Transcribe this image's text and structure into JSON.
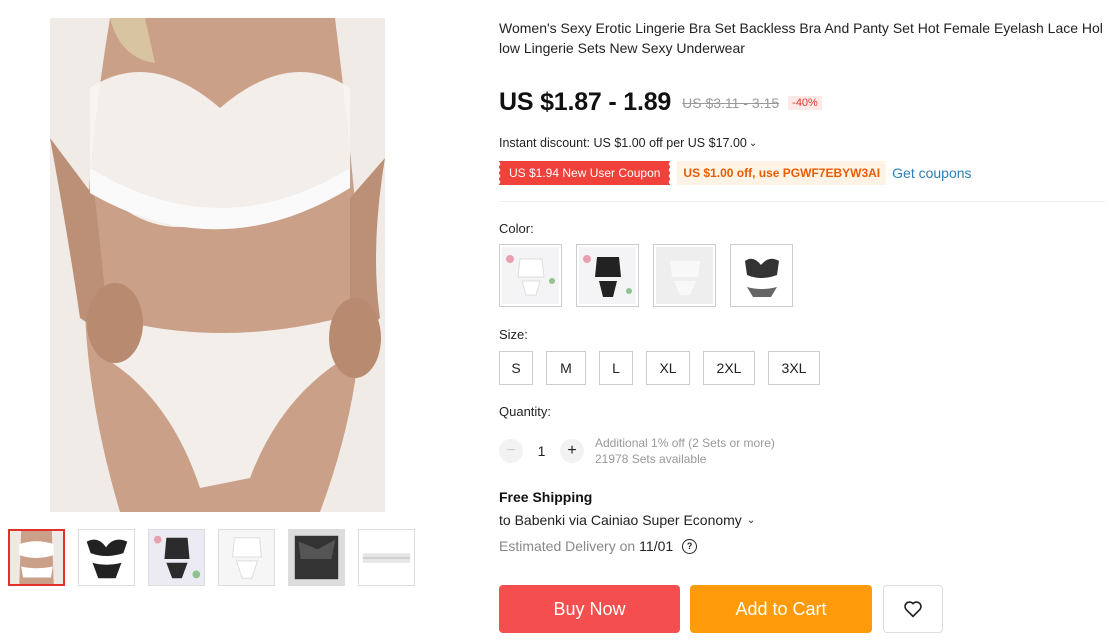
{
  "product": {
    "title": "Women's Sexy Erotic Lingerie Bra Set Backless Bra And Panty Set Hot Female Eyelash Lace Hollow Lingerie Sets New Sexy Underwear"
  },
  "price": {
    "current": "US $1.87 - 1.89",
    "original": "US $3.11 - 3.15",
    "discount": "-40%"
  },
  "instant_discount": "Instant discount: US $1.00 off per US $17.00",
  "coupons": {
    "new_user": "US $1.94 New User Coupon",
    "code_offer": "US $1.00 off, use PGWF7EBYW3AI",
    "get_link": "Get coupons"
  },
  "color": {
    "label": "Color:",
    "options": [
      "white-set",
      "black-lace-set",
      "white-sheer-set",
      "black-white-set"
    ]
  },
  "size": {
    "label": "Size:",
    "options": [
      "S",
      "M",
      "L",
      "XL",
      "2XL",
      "3XL"
    ]
  },
  "quantity": {
    "label": "Quantity:",
    "value": "1",
    "additional": "Additional 1% off (2 Sets or more)",
    "available": "21978 Sets available",
    "minus": "−",
    "plus": "+"
  },
  "shipping": {
    "title": "Free Shipping",
    "destination": "to Babenki via Cainiao Super Economy",
    "estimated_label": "Estimated Delivery on",
    "estimated_date": "11/01"
  },
  "actions": {
    "buy_now": "Buy Now",
    "add_to_cart": "Add to Cart"
  },
  "icons": {
    "chevron": "chevron-down-icon",
    "help": "question-circle-icon",
    "wishlist": "heart-icon"
  },
  "colors": {
    "accent_red": "#f44e4e",
    "accent_orange": "#ff9a0a",
    "link_blue": "#2c7fb8"
  }
}
